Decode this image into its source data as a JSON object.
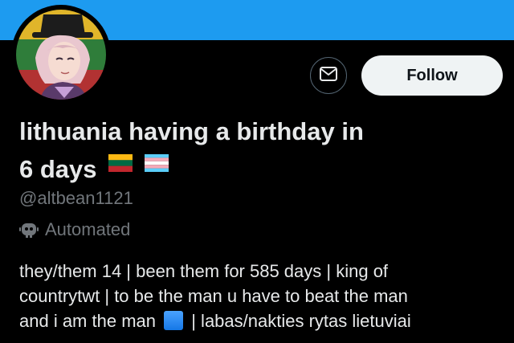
{
  "profile": {
    "name_line1": "lithuania having a birthday in",
    "name_line2": "6 days",
    "handle": "@altbean1121",
    "automated_label": "Automated",
    "bio_lines": [
      "they/them 14 | been them for 585 days | king of",
      "countrytwt | to be the man u have to beat the man",
      "and i am the man",
      "| labas/nakties rytas lietuviai"
    ]
  },
  "actions": {
    "follow_label": "Follow",
    "message_icon": "envelope-icon"
  },
  "icons": {
    "avatar": "anime-character-avatar",
    "flags": [
      "lithuania-flag-icon",
      "transgender-flag-icon"
    ],
    "automated": "robot-icon",
    "bio_emoji": "blue-square-icon"
  },
  "colors": {
    "banner": "#1d9bf0",
    "background": "#000000",
    "text": "#e7e9ea",
    "secondary_text": "#71767b",
    "follow_button_bg": "#eff3f4",
    "follow_button_text": "#0f1419"
  }
}
